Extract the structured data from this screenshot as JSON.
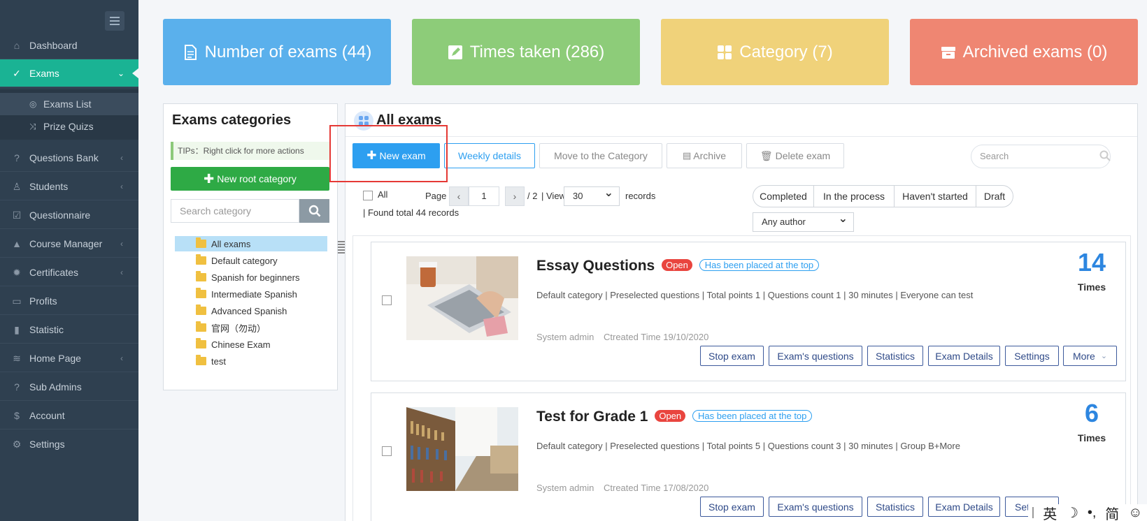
{
  "sidebar": {
    "items": [
      {
        "label": "Dashboard",
        "icon": "home-icon"
      },
      {
        "label": "Exams",
        "icon": "check-circle-icon"
      },
      {
        "label": "Questions Bank",
        "icon": "question-icon"
      },
      {
        "label": "Students",
        "icon": "user-icon"
      },
      {
        "label": "Questionnaire",
        "icon": "checkbox-icon"
      },
      {
        "label": "Course Manager",
        "icon": "graduation-icon"
      },
      {
        "label": "Certificates",
        "icon": "seal-icon"
      },
      {
        "label": "Profits",
        "icon": "card-icon"
      },
      {
        "label": "Statistic",
        "icon": "bar-chart-icon"
      },
      {
        "label": "Home Page",
        "icon": "layers-icon"
      },
      {
        "label": "Sub Admins",
        "icon": "question-icon"
      },
      {
        "label": "Account",
        "icon": "dollar-icon"
      },
      {
        "label": "Settings",
        "icon": "gear-icon"
      }
    ],
    "sub_items": [
      {
        "label": "Exams List"
      },
      {
        "label": "Prize Quizs"
      }
    ]
  },
  "stats": [
    {
      "label": "Number of exams (44)",
      "color": "#5ab0ec"
    },
    {
      "label": "Times taken (286)",
      "color": "#8dcc79"
    },
    {
      "label": "Category (7)",
      "color": "#f0d27a"
    },
    {
      "label": "Archived exams (0)",
      "color": "#ef8672"
    }
  ],
  "categories": {
    "title": "Exams categories",
    "tips": "TIPs：Right click for more actions",
    "new_root": "New root category",
    "search_placeholder": "Search category",
    "tree": [
      "All exams",
      "Default category",
      "Spanish for beginners",
      "Intermediate Spanish",
      "Advanced Spanish",
      "官网（勿动）",
      "Chinese Exam",
      "test"
    ]
  },
  "exams": {
    "title": "All exams",
    "toolbar": {
      "new_exam": "New exam",
      "weekly": "Weekly details",
      "move": "Move to the Category",
      "archive": "Archive",
      "delete": "Delete exam"
    },
    "search_placeholder": "Search",
    "pager": {
      "all": "All",
      "page_label": "Page",
      "page": "1",
      "total_pages": "/ 2",
      "view": "| View",
      "per_page": "30",
      "records": "records",
      "found": "| Found total 44 records"
    },
    "filters": [
      "Completed",
      "In the process",
      "Haven't started",
      "Draft"
    ],
    "author": "Any author",
    "list": [
      {
        "title": "Essay Questions",
        "status": "Open",
        "top": "Has been placed at the top",
        "meta": "Default category | Preselected questions | Total points 1 | Questions count 1 | 30 minutes | Everyone can test",
        "author": "System admin",
        "created": "Ctreated Time 19/10/2020",
        "times": "14",
        "times_label": "Times"
      },
      {
        "title": "Test for Grade 1",
        "status": "Open",
        "top": "Has been placed at the top",
        "meta": "Default category | Preselected questions | Total points 5 | Questions count 3 | 30 minutes | Group B+More",
        "author": "System admin",
        "created": "Ctreated Time 17/08/2020",
        "times": "6",
        "times_label": "Times"
      }
    ],
    "actions": [
      "Stop exam",
      "Exam's questions",
      "Statistics",
      "Exam Details",
      "Settings",
      "More"
    ],
    "actions_truncated": [
      "Stop exam",
      "Exam's questions",
      "Statistics",
      "Exam Details",
      "Set"
    ]
  },
  "ime": [
    "英",
    "☽",
    "•,",
    "简",
    "☺"
  ]
}
